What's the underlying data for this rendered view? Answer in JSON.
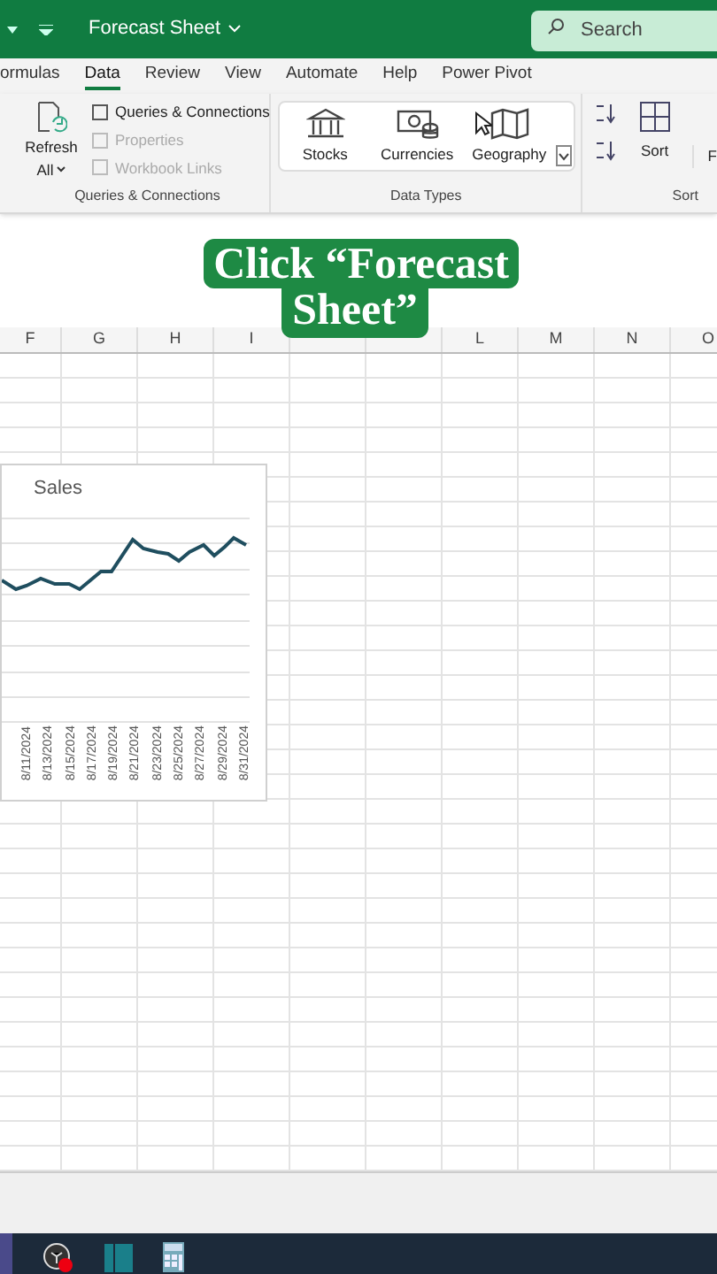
{
  "title_bar": {
    "title": "Forecast Sheet",
    "search": {
      "placeholder": "Search"
    }
  },
  "ribbon_tabs": [
    {
      "label": "ormulas",
      "selected": false
    },
    {
      "label": "Data",
      "selected": true
    },
    {
      "label": "Review",
      "selected": false
    },
    {
      "label": "View",
      "selected": false
    },
    {
      "label": "Automate",
      "selected": false
    },
    {
      "label": "Help",
      "selected": false
    },
    {
      "label": "Power Pivot",
      "selected": false
    }
  ],
  "queries_group": {
    "refresh": [
      "Refresh",
      "All"
    ],
    "label": "Queries & Connections",
    "items": [
      {
        "label": "Queries & Connections",
        "disabled": false
      },
      {
        "label": "Properties",
        "disabled": true
      },
      {
        "label": "Workbook Links",
        "disabled": true
      }
    ]
  },
  "data_types_group": {
    "label": "Data Types",
    "items": [
      {
        "label": "Stocks",
        "kind": "bank"
      },
      {
        "label": "Currencies",
        "kind": "money"
      },
      {
        "label": "Geography",
        "kind": "map"
      }
    ]
  },
  "sort_group": {
    "button": "Sort",
    "label": "Sort",
    "cut_button": "F"
  },
  "callout": {
    "lines": [
      "Click “Forecast",
      "Sheet”"
    ]
  },
  "columns_left": [
    "F",
    "G",
    "H",
    "I"
  ],
  "columns_right": [
    "L",
    "M",
    "N",
    "O"
  ],
  "chart": {
    "title": "Sales",
    "x_labels": [
      "8/11/2024",
      "8/13/2024",
      "8/15/2024",
      "8/17/2024",
      "8/19/2024",
      "8/21/2024",
      "8/23/2024",
      "8/25/2024",
      "8/27/2024",
      "8/29/2024",
      "8/31/2024"
    ]
  }
}
